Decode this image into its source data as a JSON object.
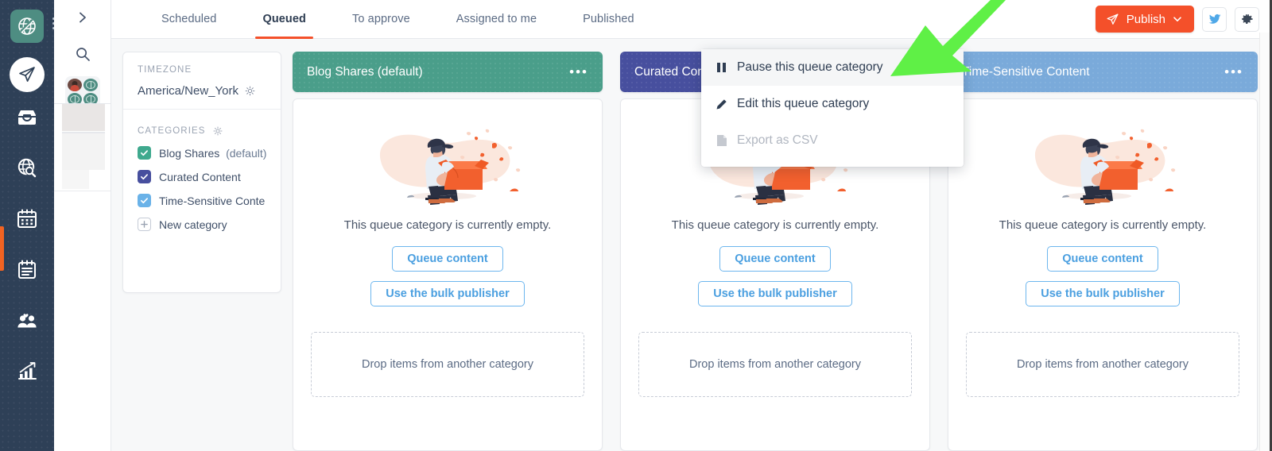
{
  "rail": {
    "logo_icon": "globe-logo-icon",
    "kebab_icon": "kebab-menu-icon",
    "active_marker_color": "#f26322",
    "items": [
      {
        "icon": "paper-plane-compose-icon",
        "name": "compose"
      },
      {
        "icon": "inbox-icon",
        "name": "inbox"
      },
      {
        "icon": "globe-search-icon",
        "name": "discovery"
      },
      {
        "icon": "calendar-icon",
        "name": "calendar"
      },
      {
        "icon": "queue-clipboard-icon",
        "name": "queue"
      },
      {
        "icon": "people-icon",
        "name": "audience"
      },
      {
        "icon": "analytics-bar-chart-icon",
        "name": "analytics"
      }
    ]
  },
  "panel2": {
    "expand_icon": "chevron-right-icon",
    "search_icon": "search-icon",
    "avatars": [
      "person-avatar",
      "globe-avatar",
      "globe-avatar",
      "globe-avatar"
    ]
  },
  "topbar": {
    "tabs": [
      {
        "label": "Scheduled",
        "active": false
      },
      {
        "label": "Queued",
        "active": true
      },
      {
        "label": "To approve",
        "active": false
      },
      {
        "label": "Assigned to me",
        "active": false
      },
      {
        "label": "Published",
        "active": false
      }
    ],
    "publish": {
      "label": "Publish",
      "icon": "paper-plane-icon",
      "chevron": "chevron-down-icon",
      "color": "#f4502a"
    },
    "twitter_icon": "twitter-bird-icon",
    "settings_icon": "gear-icon"
  },
  "sidecard": {
    "timezone_label": "TIMEZONE",
    "timezone_value": "America/New_York",
    "timezone_gear_icon": "gear-icon",
    "categories_label": "CATEGORIES",
    "categories_gear_icon": "gear-icon",
    "categories": [
      {
        "name": "Blog Shares",
        "suffix": "(default)",
        "checked": true,
        "color": "#3fa98e"
      },
      {
        "name": "Curated Content",
        "suffix": "",
        "checked": true,
        "color": "#474f9e"
      },
      {
        "name": "Time-Sensitive Conte",
        "suffix": "",
        "checked": true,
        "color": "#6ab2e8"
      }
    ],
    "new_category_label": "New category",
    "new_category_icon": "plus-box-icon"
  },
  "columns": [
    {
      "title": "Blog Shares (default)",
      "header_color": "#4a9e8a",
      "menu_icon": "ellipsis-icon",
      "empty_message": "This queue category is currently empty.",
      "queue_button": "Queue content",
      "bulk_button": "Use the bulk publisher",
      "dropzone": "Drop items from another category",
      "illustration": "person-carrying-box-illustration"
    },
    {
      "title": "Curated Content",
      "header_color": "#474f9e",
      "menu_icon": "ellipsis-icon",
      "empty_message": "This queue category is currently empty.",
      "queue_button": "Queue content",
      "bulk_button": "Use the bulk publisher",
      "dropzone": "Drop items from another category",
      "illustration": "person-carrying-box-illustration"
    },
    {
      "title": "Time-Sensitive Content",
      "header_color": "#7aaada",
      "menu_icon": "ellipsis-icon",
      "empty_message": "This queue category is currently empty.",
      "queue_button": "Queue content",
      "bulk_button": "Use the bulk publisher",
      "dropzone": "Drop items from another category",
      "illustration": "person-carrying-box-illustration"
    }
  ],
  "context_menu": {
    "items": [
      {
        "label": "Pause this queue category",
        "icon": "pause-icon",
        "disabled": false,
        "hover": true
      },
      {
        "label": "Edit this queue category",
        "icon": "pencil-icon",
        "disabled": false,
        "hover": false
      },
      {
        "label": "Export as CSV",
        "icon": "file-csv-icon",
        "disabled": true,
        "hover": false
      }
    ]
  },
  "annotation": {
    "arrow_icon": "green-pointer-arrow",
    "arrow_color": "#5ff046"
  }
}
